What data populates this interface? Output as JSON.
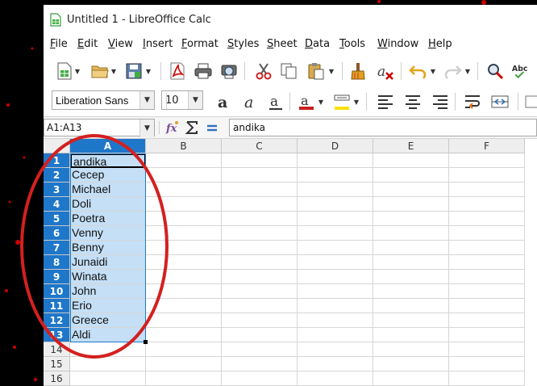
{
  "window": {
    "title": "Untitled 1 - LibreOffice Calc"
  },
  "menubar": {
    "items": [
      {
        "label": "File",
        "underline": "F"
      },
      {
        "label": "Edit",
        "underline": "E"
      },
      {
        "label": "View",
        "underline": "V"
      },
      {
        "label": "Insert",
        "underline": "I"
      },
      {
        "label": "Format",
        "underline": "F"
      },
      {
        "label": "Styles",
        "underline": "S"
      },
      {
        "label": "Sheet",
        "underline": "S"
      },
      {
        "label": "Data",
        "underline": "D"
      },
      {
        "label": "Tools",
        "underline": "T"
      },
      {
        "label": "Window",
        "underline": "W"
      },
      {
        "label": "Help",
        "underline": "H"
      }
    ]
  },
  "toolbar": {
    "font_name": "Liberation Sans",
    "font_size": "10"
  },
  "formula_bar": {
    "name_box": "A1:A13",
    "content": "andika"
  },
  "sheet": {
    "columns": [
      "A",
      "B",
      "C",
      "D",
      "E",
      "F"
    ],
    "selected_column": "A",
    "rows": [
      {
        "num": "1",
        "a": "andika",
        "selected": true
      },
      {
        "num": "2",
        "a": "Cecep",
        "selected": true
      },
      {
        "num": "3",
        "a": "Michael",
        "selected": true
      },
      {
        "num": "4",
        "a": "Doli",
        "selected": true
      },
      {
        "num": "5",
        "a": "Poetra",
        "selected": true
      },
      {
        "num": "6",
        "a": "Venny",
        "selected": true
      },
      {
        "num": "7",
        "a": "Benny",
        "selected": true
      },
      {
        "num": "8",
        "a": "Junaidi",
        "selected": true
      },
      {
        "num": "9",
        "a": "Winata",
        "selected": true
      },
      {
        "num": "10",
        "a": "John",
        "selected": true
      },
      {
        "num": "11",
        "a": "Erio",
        "selected": true
      },
      {
        "num": "12",
        "a": "Greece",
        "selected": true
      },
      {
        "num": "13",
        "a": "Aldi",
        "selected": true
      },
      {
        "num": "14",
        "a": "",
        "selected": false
      },
      {
        "num": "15",
        "a": "",
        "selected": false
      },
      {
        "num": "16",
        "a": "",
        "selected": false
      }
    ]
  },
  "colors": {
    "selection_accent": "#1f77c9",
    "selection_fill": "#c4dff6",
    "annotation_red": "#d42020"
  }
}
